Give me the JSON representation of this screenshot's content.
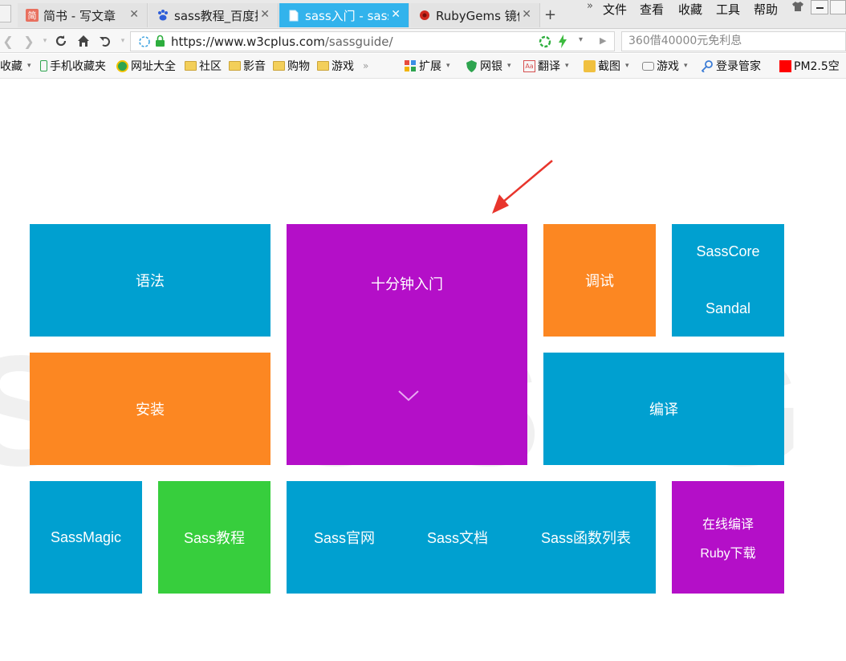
{
  "tabs": [
    {
      "label": "简书 - 写文章",
      "icon": "jianshu-icon",
      "icon_color": "#e8705f",
      "active": false
    },
    {
      "label": "sass教程_百度搜索",
      "icon": "baidu-paw-icon",
      "icon_color": "#2f5fd8",
      "active": false
    },
    {
      "label": "sass入门 - sass",
      "icon": "page-icon",
      "icon_color": "#ffffff",
      "active": true
    },
    {
      "label": "RubyGems 镜像",
      "icon": "ruby-icon",
      "icon_color": "#d0281e",
      "active": false
    }
  ],
  "new_tab": "+",
  "menu": {
    "chevron": "»",
    "items": [
      "文件",
      "查看",
      "收藏",
      "工具",
      "帮助"
    ]
  },
  "address": {
    "url_host": "https://www.w3cplus.com",
    "url_path": "/sassguide/",
    "search_placeholder": "360借40000元免利息"
  },
  "bookmarks": {
    "items": [
      {
        "label": "收藏",
        "icon": "star-icon",
        "dropdown": true
      },
      {
        "label": "手机收藏夹",
        "icon": "phone-icon",
        "dropdown": false
      },
      {
        "label": "网址大全",
        "icon": "globe-icon",
        "dropdown": false
      },
      {
        "label": "社区",
        "icon": "folder-icon",
        "dropdown": false
      },
      {
        "label": "影音",
        "icon": "folder-icon",
        "dropdown": false
      },
      {
        "label": "购物",
        "icon": "folder-icon",
        "dropdown": false
      },
      {
        "label": "游戏",
        "icon": "folder-icon",
        "dropdown": false
      }
    ],
    "overflow": "»",
    "tools": [
      {
        "label": "扩展",
        "icon": "grid-icon",
        "dropdown": true
      },
      {
        "label": "网银",
        "icon": "shield-icon",
        "dropdown": true
      },
      {
        "label": "翻译",
        "icon": "translate-icon",
        "dropdown": true
      },
      {
        "label": "截图",
        "icon": "scissors-icon",
        "dropdown": true
      },
      {
        "label": "游戏",
        "icon": "gamepad-icon",
        "dropdown": true
      },
      {
        "label": "登录管家",
        "icon": "key-icon",
        "dropdown": false
      },
      {
        "label": "PM2.5空",
        "icon": "pm25-icon",
        "dropdown": false
      }
    ]
  },
  "page": {
    "watermark": "SASS GUIDE",
    "tiles": {
      "grammar": "语法",
      "ten_minutes": "十分钟入门",
      "debug": "调试",
      "sasscore": "SassCore",
      "sandal": "Sandal",
      "install": "安装",
      "compile": "编译",
      "sassmagic": "SassMagic",
      "sass_tutorial": "Sass教程",
      "sass_official": "Sass官网",
      "sass_docs": "Sass文档",
      "sass_functions": "Sass函数列表",
      "online_compile": "在线编译",
      "ruby_download": "Ruby下载"
    }
  },
  "colors": {
    "blue": "#00a0d0",
    "purple": "#b40fc8",
    "orange": "#fc8722",
    "green": "#37ce3d",
    "active_tab": "#32b3ec",
    "arrow": "#e8352c"
  }
}
